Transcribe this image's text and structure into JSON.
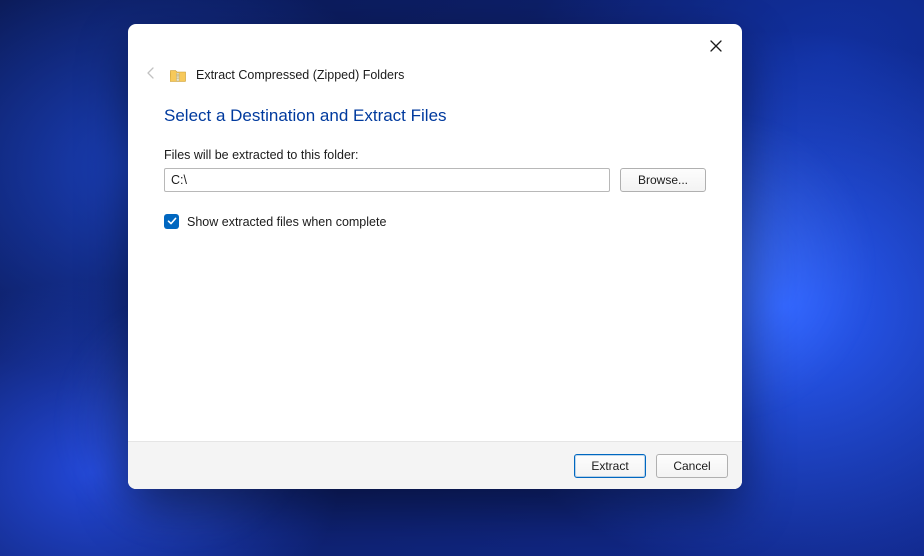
{
  "dialog": {
    "window_title": "Extract Compressed (Zipped) Folders",
    "heading": "Select a Destination and Extract Files",
    "path_label": "Files will be extracted to this folder:",
    "path_value": "C:\\",
    "browse_label": "Browse...",
    "show_files_checkbox": {
      "label": "Show extracted files when complete",
      "checked": true
    },
    "footer": {
      "extract_label": "Extract",
      "cancel_label": "Cancel"
    }
  }
}
